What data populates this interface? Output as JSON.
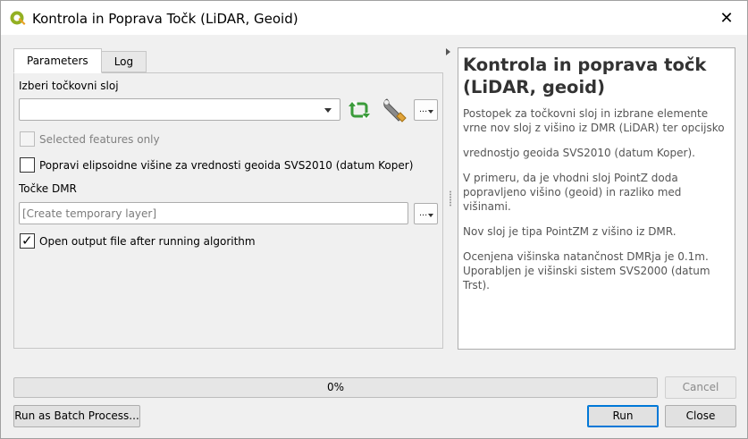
{
  "window": {
    "title": "Kontrola in Poprava Točk (LiDAR, Geoid)",
    "close_glyph": "✕",
    "app_icon": "qgis-logo-icon"
  },
  "tabs": [
    {
      "label": "Parameters",
      "active": true
    },
    {
      "label": "Log",
      "active": false
    }
  ],
  "parameters": {
    "input_layer_label": "Izberi točkovni sloj",
    "input_layer_value": "",
    "selected_only_label": "Selected features only",
    "selected_only_checked": false,
    "correct_heights_label": "Popravi elipsoidne višine za vrednosti geoida SVS2010 (datum Koper)",
    "correct_heights_checked": false,
    "output_label": "Točke DMR",
    "output_placeholder": "[Create temporary layer]",
    "open_output_label": "Open output file after running algorithm",
    "open_output_checked": true,
    "browse_glyph": "...",
    "icons": {
      "iterate": "iterate-icon",
      "settings": "wrench-icon"
    }
  },
  "help": {
    "title": "Kontrola in poprava točk (LiDAR, geoid)",
    "paragraphs": [
      "Postopek za točkovni sloj in izbrane elemente vrne nov sloj z višino iz DMR (LiDAR) ter opcijsko",
      "vrednostjo geoida SVS2010 (datum Koper).",
      "V primeru, da je vhodni sloj PointZ doda popravljeno višino (geoid) in razliko med višinami.",
      "Nov sloj je tipa PointZM z višino iz DMR.",
      "Ocenjena višinska natančnost DMRja je 0.1m. Uporabljen je višinski sistem SVS2000 (datum Trst)."
    ]
  },
  "footer": {
    "progress_percent": 0,
    "progress_text": "0%",
    "cancel_label": "Cancel",
    "batch_label": "Run as Batch Process...",
    "run_label": "Run",
    "close_label": "Close"
  },
  "colors": {
    "accent": "#0078d7",
    "iterate_icon": "#3a9b3a",
    "help_title": "#333333",
    "help_text": "#555555"
  }
}
